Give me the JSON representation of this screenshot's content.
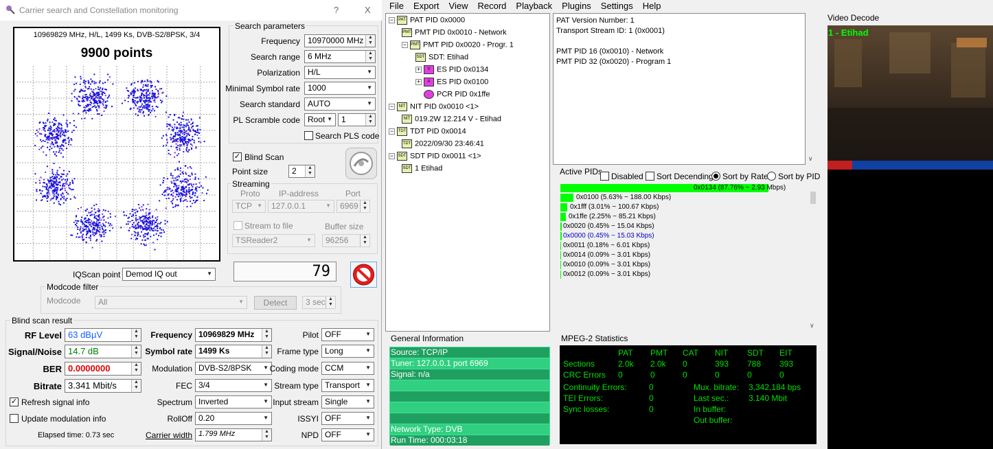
{
  "left_window": {
    "title": "Carrier search and Constellation monitoring",
    "help_button": "?",
    "close_button": "X",
    "constellation": {
      "info": "10969829 MHz, H/L, 1499 Ks, DVB-S2/8PSK, 3/4",
      "points": "9900 points"
    },
    "search": {
      "group_title": "Search parameters",
      "frequency_label": "Frequency",
      "frequency_value": "10970000 MHz",
      "range_label": "Search range",
      "range_value": "6 MHz",
      "polarization_label": "Polarization",
      "polarization_value": "H/L",
      "minsr_label": "Minimal Symbol rate",
      "minsr_value": "1000",
      "standard_label": "Search standard",
      "standard_value": "AUTO",
      "pl_label": "PL Scramble code",
      "pl_mode": "Root",
      "pl_value": "1",
      "search_pls_label": "Search PLS code"
    },
    "blind_scan_label": "Blind Scan",
    "point_size_label": "Point size",
    "point_size_value": "2",
    "streaming": {
      "group_title": "Streaming",
      "proto_label": "Proto",
      "ip_label": "IP-address",
      "port_label": "Port",
      "proto_value": "TCP",
      "ip_value": "127.0.0.1",
      "port_value": "6969",
      "stream_to_file_label": "Stream to file",
      "buffer_label": "Buffer size",
      "file_format": "TSReader2",
      "buffer_value": "96256"
    },
    "counter": "79",
    "iqscan_label": "IQScan point",
    "iqscan_value": "Demod IQ out",
    "modcode": {
      "group_title": "Modcode filter",
      "label": "Modcode",
      "value": "All",
      "detect_label": "Detect",
      "time_value": "3 sec"
    },
    "result": {
      "group_title": "Blind scan result",
      "rf_label": "RF Level",
      "rf_value": "63 dBµV",
      "sn_label": "Signal/Noise",
      "sn_value": "14.7 dB",
      "ber_label": "BER",
      "ber_value": "0.0000000",
      "bitrate_label": "Bitrate",
      "bitrate_value": "3.341 Mbit/s",
      "freq_label": "Frequency",
      "freq_value": "10969829 MHz",
      "sr_label": "Symbol rate",
      "sr_value": "1499 Ks",
      "mod_label": "Modulation",
      "mod_value": "DVB-S2/8PSK",
      "fec_label": "FEC",
      "fec_value": "3/4",
      "spectrum_label": "Spectrum",
      "spectrum_value": "Inverted",
      "rolloff_label": "RollOff",
      "rolloff_value": "0.20",
      "cw_label": "Carrier width",
      "cw_value": "1.799 MHz",
      "pilot_label": "Pilot",
      "pilot_value": "OFF",
      "frame_label": "Frame type",
      "frame_value": "Long",
      "coding_label": "Coding mode",
      "coding_value": "CCM",
      "stype_label": "Stream type",
      "stype_value": "Transport",
      "input_label": "Input stream",
      "input_value": "Single",
      "issyi_label": "ISSYI",
      "issyi_value": "OFF",
      "npd_label": "NPD",
      "npd_value": "OFF"
    },
    "refresh_label": "Refresh signal info",
    "update_label": "Update modulation info",
    "elapsed": "Elapsed time: 0.73 sec"
  },
  "menu": [
    "File",
    "Export",
    "View",
    "Record",
    "Playback",
    "Plugins",
    "Settings",
    "Help"
  ],
  "tree": [
    {
      "label": "PAT PID 0x0000",
      "icon": "PAT"
    },
    {
      "label": "PMT PID 0x0010 - Network",
      "icon": "PMT"
    },
    {
      "label": "PMT PID 0x0020 - Progr. 1",
      "icon": "PMT"
    },
    {
      "label": "SDT: Etihad",
      "icon": "SDT"
    },
    {
      "label": "ES PID 0x0134",
      "icon": "video"
    },
    {
      "label": "ES PID 0x0100",
      "icon": "audio"
    },
    {
      "label": "PCR PID 0x1ffe",
      "icon": "pcr"
    },
    {
      "label": "NIT PID 0x0010 <1>",
      "icon": "NIT"
    },
    {
      "label": "019.2W 12.214 V - Etihad",
      "icon": "NIT"
    },
    {
      "label": "TDT PID 0x0014",
      "icon": "TDT"
    },
    {
      "label": "2022/09/30 23:46:41",
      "icon": "TDT"
    },
    {
      "label": "SDT PID 0x0011 <1>",
      "icon": "SDT"
    },
    {
      "label": "1 Etihad",
      "icon": "SDT"
    }
  ],
  "details": [
    "PAT Version Number: 1",
    "Transport Stream ID: 1 (0x0001)",
    "",
    "PMT PID 16 (0x0010) - Network",
    "PMT PID 32 (0x0020) - Program 1"
  ],
  "active_pids": {
    "title": "Active PIDs",
    "disabled_label": "Disabled",
    "sort_desc_label": "Sort Decending",
    "sort_rate_label": "Sort by Rate",
    "sort_pid_label": "Sort by PID",
    "rows": [
      {
        "text": "0x0134 (87.76% ~ 2.93 Mbps)",
        "fraction": 0.8776,
        "color": "#000000"
      },
      {
        "text": "0x0100 (5.63% ~ 188.00 Kbps)",
        "fraction": 0.0563,
        "color": "#000000"
      },
      {
        "text": "0x1fff (3.01% ~ 100.67 Kbps)",
        "fraction": 0.0301,
        "color": "#000000"
      },
      {
        "text": "0x1ffe (2.25% ~ 85.21 Kbps)",
        "fraction": 0.0225,
        "color": "#000000"
      },
      {
        "text": "0x0020 (0.45% ~ 15.04 Kbps)",
        "fraction": 0.0045,
        "color": "#000000"
      },
      {
        "text": "0x0000 (0.45% ~ 15.03 Kbps)",
        "fraction": 0.0045,
        "color": "#0000cc"
      },
      {
        "text": "0x0011 (0.18% ~ 6.01 Kbps)",
        "fraction": 0.0018,
        "color": "#000000"
      },
      {
        "text": "0x0014 (0.09% ~ 3.01 Kbps)",
        "fraction": 0.0009,
        "color": "#000000"
      },
      {
        "text": "0x0010 (0.09% ~ 3.01 Kbps)",
        "fraction": 0.0009,
        "color": "#000000"
      },
      {
        "text": "0x0012 (0.09% ~ 3.01 Kbps)",
        "fraction": 0.0009,
        "color": "#000000"
      }
    ]
  },
  "general_info": {
    "title": "General Information",
    "lines": [
      "Source: TCP/IP",
      "Tuner: 127.0.0.1 port 6969",
      "Signal: n/a",
      "",
      "",
      "",
      "",
      "Network Type: DVB",
      "Run Time: 000:03:18"
    ]
  },
  "mpeg_stats": {
    "title": "MPEG-2 Statistics",
    "headers": [
      "PAT",
      "PMT",
      "CAT",
      "NIT",
      "SDT",
      "EIT"
    ],
    "sections_label": "Sections",
    "sections": [
      "2.0k",
      "2.0k",
      "0",
      "393",
      "788",
      "393"
    ],
    "crc_label": "CRC Errors",
    "crc": [
      "0",
      "0",
      "0",
      "0",
      "0",
      "0"
    ],
    "cont_label": "Continuity Errors:",
    "cont_value": "0",
    "tei_label": "TEI Errors:",
    "tei_value": "0",
    "sync_label": "Sync losses:",
    "sync_value": "0",
    "mux_label": "Mux. bitrate:",
    "mux_value": "3,342,184 bps",
    "last_label": "Last sec.:",
    "last_value": "3.140 Mbit",
    "inbuf_label": "In buffer:",
    "outbuf_label": "Out buffer:"
  },
  "video": {
    "title": "Video Decode",
    "channel": "1 - Etihad"
  }
}
